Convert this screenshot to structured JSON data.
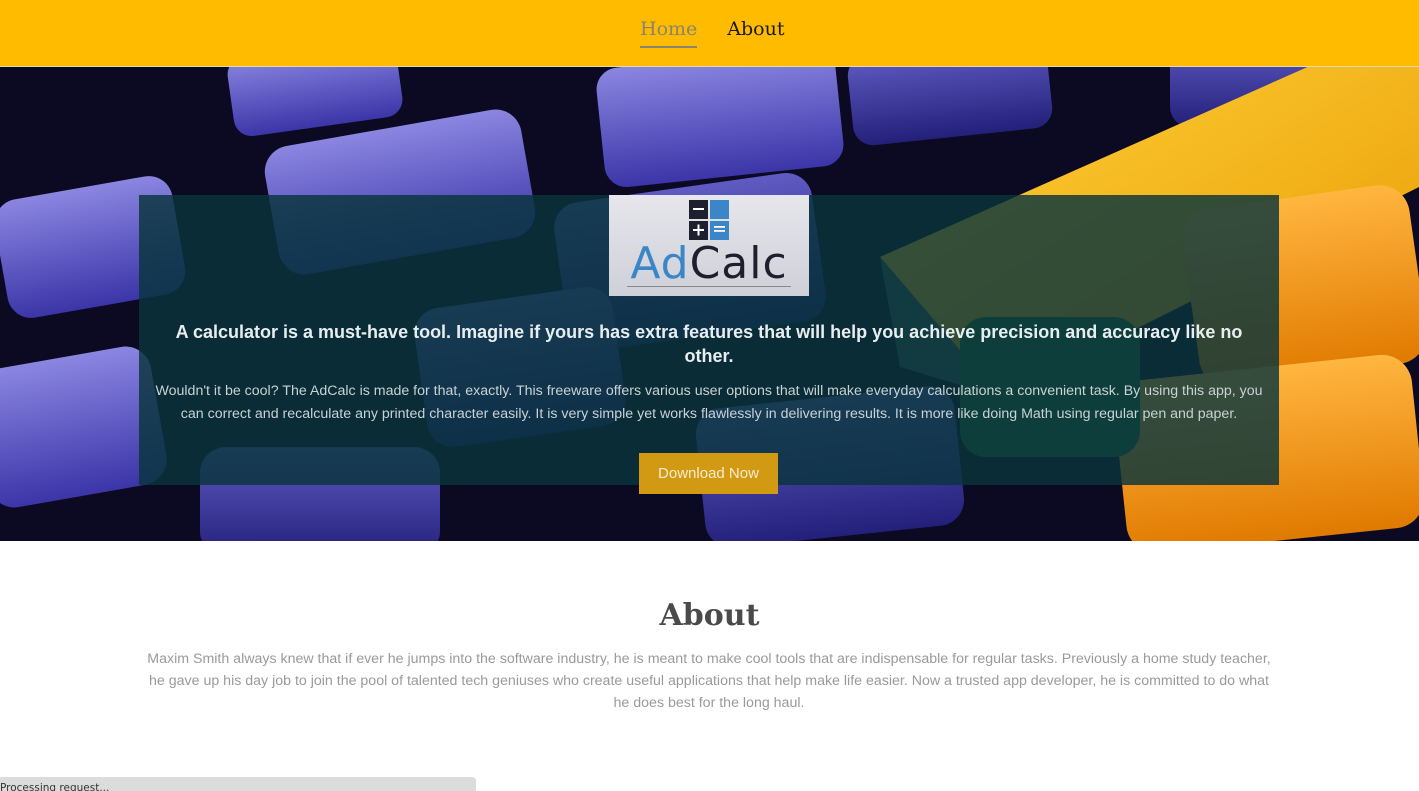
{
  "nav": {
    "items": [
      {
        "label": "Home",
        "active": true
      },
      {
        "label": "About",
        "active": false
      }
    ]
  },
  "hero": {
    "logo": {
      "part1": "Ad",
      "part2": "Calc"
    },
    "headline": "A calculator is a must-have tool. Imagine if yours has extra features that will help you achieve precision and accuracy like no other.",
    "description": "Wouldn't it be cool? The AdCalc is made for that, exactly. This freeware offers various user options that will make everyday calculations a convenient task. By using this app, you can correct and recalculate any printed character easily. It is very simple yet works flawlessly in delivering results. It is more like doing Math using regular pen and paper.",
    "button_label": "Download Now"
  },
  "about": {
    "title": "About",
    "text": "Maxim Smith always knew that if ever he jumps into the software industry, he is meant to make cool tools that are indispensable for regular tasks. Previously a home study teacher, he gave up his day job to join the pool of talented tech geniuses who create useful applications that help make life easier. Now a trusted app developer, he is committed to do what he does best for the long haul."
  },
  "status": {
    "text": "Processing request..."
  },
  "colors": {
    "nav_bg": "#ffbb00",
    "button_bg": "#d29a12",
    "panel_bg": "#08343c"
  }
}
